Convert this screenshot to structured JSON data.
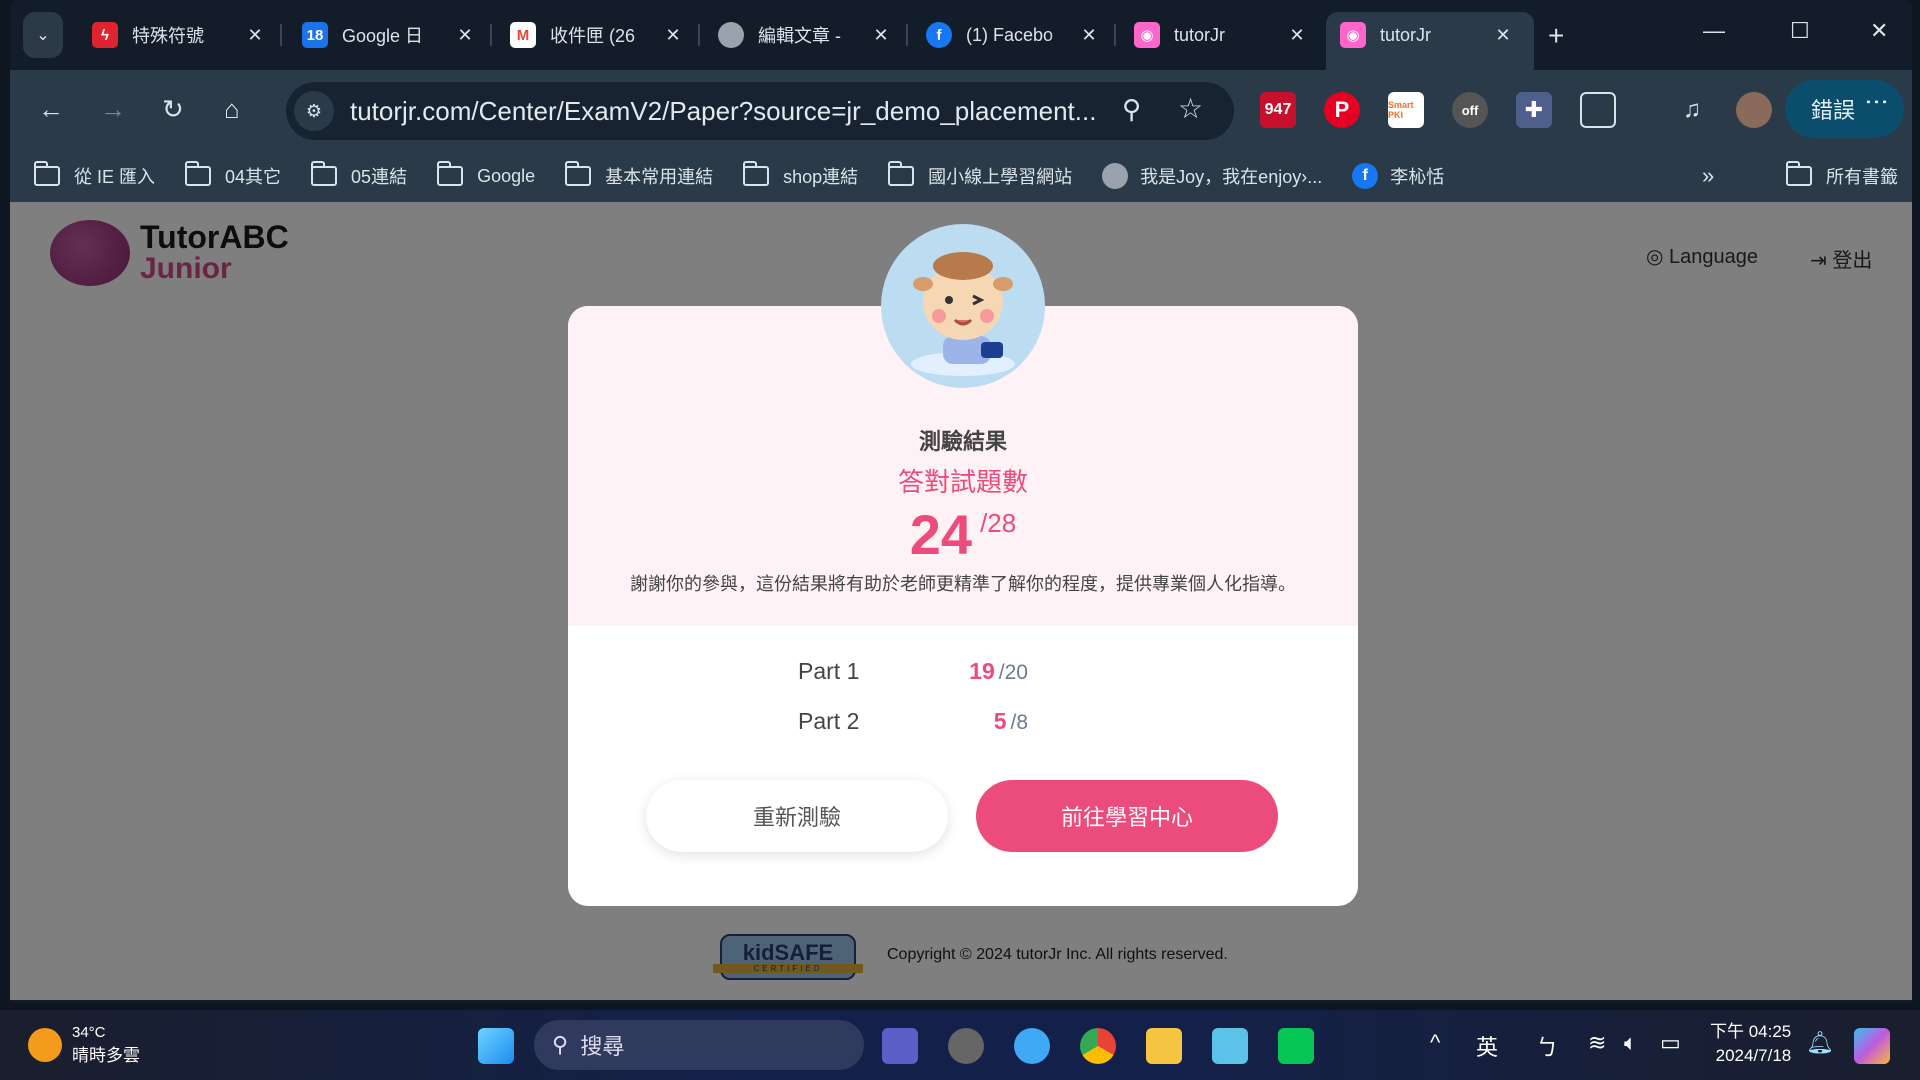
{
  "browser": {
    "tabs": [
      {
        "label": "特殊符號",
        "icon": "lightning-icon",
        "color": "#e0242f"
      },
      {
        "label": "Google 日",
        "icon": "calendar-icon",
        "color": "#1a73e8",
        "badge": "18"
      },
      {
        "label": "收件匣 (26",
        "icon": "gmail-icon",
        "color": "#ea4335"
      },
      {
        "label": "編輯文章 -",
        "icon": "globe-icon",
        "color": "#9aa3ad"
      },
      {
        "label": "(1) Facebo",
        "icon": "facebook-icon",
        "color": "#1877f2"
      },
      {
        "label": "tutorJr",
        "icon": "tutorjr-icon",
        "color": "#ff66cc"
      },
      {
        "label": "tutorJr",
        "icon": "tutorjr-icon",
        "color": "#ff66cc",
        "active": true
      }
    ],
    "url": "tutorjr.com/Center/ExamV2/Paper?source=jr_demo_placement...",
    "extensions": {
      "mail_count": "947",
      "off_label": "off"
    },
    "error_button": "錯誤",
    "bookmarks": [
      {
        "label": "從 IE 匯入",
        "type": "folder"
      },
      {
        "label": "04其它",
        "type": "folder"
      },
      {
        "label": "05連結",
        "type": "folder"
      },
      {
        "label": "Google",
        "type": "folder"
      },
      {
        "label": "基本常用連結",
        "type": "folder"
      },
      {
        "label": "shop連結",
        "type": "folder"
      },
      {
        "label": "國小線上學習網站",
        "type": "folder"
      },
      {
        "label": "我是Joy，我在enjoy›...",
        "type": "globe"
      },
      {
        "label": "李杺恬",
        "type": "facebook"
      }
    ],
    "all_bookmarks": "所有書籤"
  },
  "site": {
    "logo_line1": "TutorABC",
    "logo_line2": "Junior",
    "language": "Language",
    "logout": "登出",
    "copyright": "Copyright © 2024 tutorJr Inc. All rights reserved.",
    "kidsafe_top": "kidSAFE",
    "kidsafe_bottom": "CERTIFIED"
  },
  "modal": {
    "title": "測驗結果",
    "subtitle": "答對試題數",
    "score": "24",
    "total": "/28",
    "description": "謝謝你的參與，這份結果將有助於老師更精準了解你的程度，提供專業個人化指導。",
    "parts": [
      {
        "label": "Part 1",
        "correct": "19",
        "total": "/20"
      },
      {
        "label": "Part 2",
        "correct": "5",
        "total": "/8"
      }
    ],
    "retry_label": "重新測驗",
    "go_label": "前往學習中心",
    "accent": "#ec4c7c"
  },
  "taskbar": {
    "temperature": "34°C",
    "weather": "晴時多雲",
    "search_placeholder": "搜尋",
    "ime1": "英",
    "ime2": "ㄅ",
    "time": "下午 04:25",
    "date": "2024/7/18"
  }
}
